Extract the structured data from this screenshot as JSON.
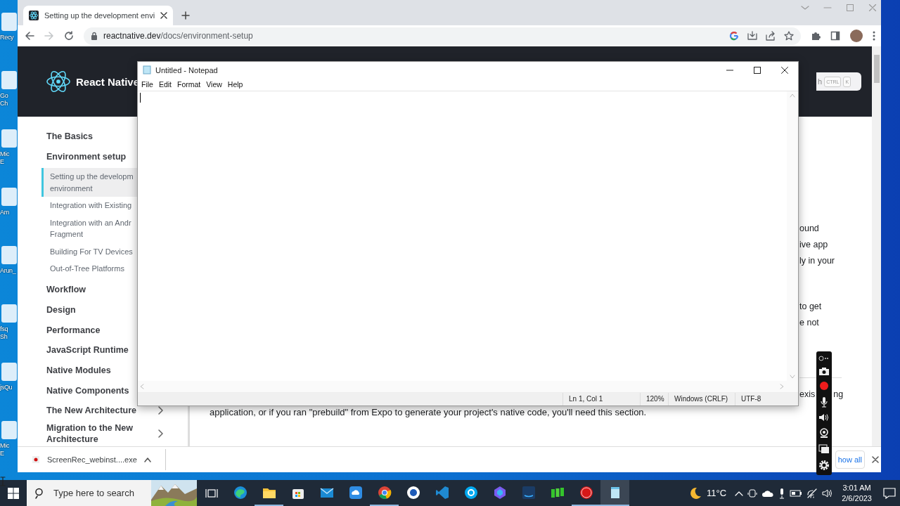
{
  "desktop_icons": [
    {
      "label": "Recy"
    },
    {
      "label": "Go\nCh"
    },
    {
      "label": "Mic\nE"
    },
    {
      "label": "Am"
    },
    {
      "label": "Arun_"
    },
    {
      "label": "fsq\nSh"
    },
    {
      "label": "jsQu"
    },
    {
      "label": "Mic\nE"
    }
  ],
  "browser": {
    "tab": {
      "title": "Setting up the development envi",
      "selected": true
    },
    "nav": {
      "forward_disabled": true
    },
    "address": {
      "host": "reactnative.dev",
      "path": "/docs/environment-setup"
    }
  },
  "site": {
    "logo": "React Native",
    "search": {
      "placeholder": "h",
      "keys": [
        "CTRL",
        "K"
      ]
    },
    "sidebar": [
      {
        "label": "The Basics"
      },
      {
        "label": "Environment setup",
        "expanded": true,
        "children": [
          {
            "label": "Setting up the developm\nenvironment",
            "selected": true
          },
          {
            "label": "Integration with Existing",
            "selected": false
          },
          {
            "label": "Integration with an Andr\nFragment",
            "selected": false
          },
          {
            "label": "Building For TV Devices",
            "selected": false
          },
          {
            "label": "Out-of-Tree Platforms",
            "selected": false
          }
        ]
      },
      {
        "label": "Workflow"
      },
      {
        "label": "Design"
      },
      {
        "label": "Performance"
      },
      {
        "label": "JavaScript Runtime"
      },
      {
        "label": "Native Modules"
      },
      {
        "label": "Native Components"
      },
      {
        "label": "The New Architecture",
        "expanded": false
      },
      {
        "label": "Migration to the New\nArchitecture",
        "expanded": false
      }
    ],
    "content": {
      "fragments": [
        "ound",
        "ive app",
        "ly in your",
        "to get",
        "e not",
        "exis",
        "ng"
      ],
      "paragraph": "application, or if you ran \"prebuild\" from Expo to generate your project's native code, you'll need this section."
    }
  },
  "download_bar": {
    "file": "ScreenRec_webinst....exe",
    "show_all": "how all"
  },
  "notepad": {
    "title": "Untitled - Notepad",
    "menu": [
      "File",
      "Edit",
      "Format",
      "View",
      "Help"
    ],
    "status": [
      "Ln 1, Col 1",
      "120%",
      "Windows (CRLF)",
      "UTF-8"
    ]
  },
  "taskbar": {
    "search_placeholder": "Type here to search",
    "apps": [
      {
        "kind": "edge",
        "running": false,
        "selected": false
      },
      {
        "kind": "explorer",
        "running": true,
        "selected": false
      },
      {
        "kind": "store",
        "running": false,
        "selected": false
      },
      {
        "kind": "mail",
        "running": false,
        "selected": false
      },
      {
        "kind": "cloud",
        "running": false,
        "selected": false
      },
      {
        "kind": "chrome",
        "running": true,
        "selected": false
      },
      {
        "kind": "circle",
        "running": false,
        "selected": false
      },
      {
        "kind": "vscode",
        "running": false,
        "selected": false
      },
      {
        "kind": "skype",
        "running": false,
        "selected": false
      },
      {
        "kind": "copilot",
        "running": false,
        "selected": false
      },
      {
        "kind": "prime",
        "running": false,
        "selected": false
      },
      {
        "kind": "bars",
        "running": false,
        "selected": false
      },
      {
        "kind": "recorder",
        "running": true,
        "selected": false
      },
      {
        "kind": "notepad",
        "running": true,
        "selected": true
      }
    ],
    "weather": "11°C",
    "time": "3:01 AM",
    "date": "2/6/2023"
  }
}
